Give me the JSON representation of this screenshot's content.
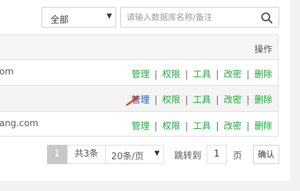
{
  "filter": {
    "select_value": "全部",
    "search_placeholder": "请输入数据库名称/备注",
    "search_value": ""
  },
  "table": {
    "header_operation": "操作",
    "rows": [
      {
        "name": "om",
        "actions": [
          "管理",
          "权限",
          "工具",
          "改密",
          "删除"
        ]
      },
      {
        "name": "",
        "actions": [
          "管理",
          "权限",
          "工具",
          "改密",
          "删除"
        ]
      },
      {
        "name": "ang.com",
        "actions": [
          "管理",
          "权限",
          "工具",
          "改密",
          "删除"
        ]
      }
    ],
    "separator": "|"
  },
  "pagination": {
    "current_page": "1",
    "total": "共3条",
    "page_size": "20条/页",
    "jump_label": "跳转到",
    "jump_value": "1",
    "page_unit": "页",
    "confirm": "确认"
  },
  "colors": {
    "action_link": "#20a53a",
    "action_hover": "#1e5aa8",
    "cursor_arrow": "#e8321e"
  }
}
